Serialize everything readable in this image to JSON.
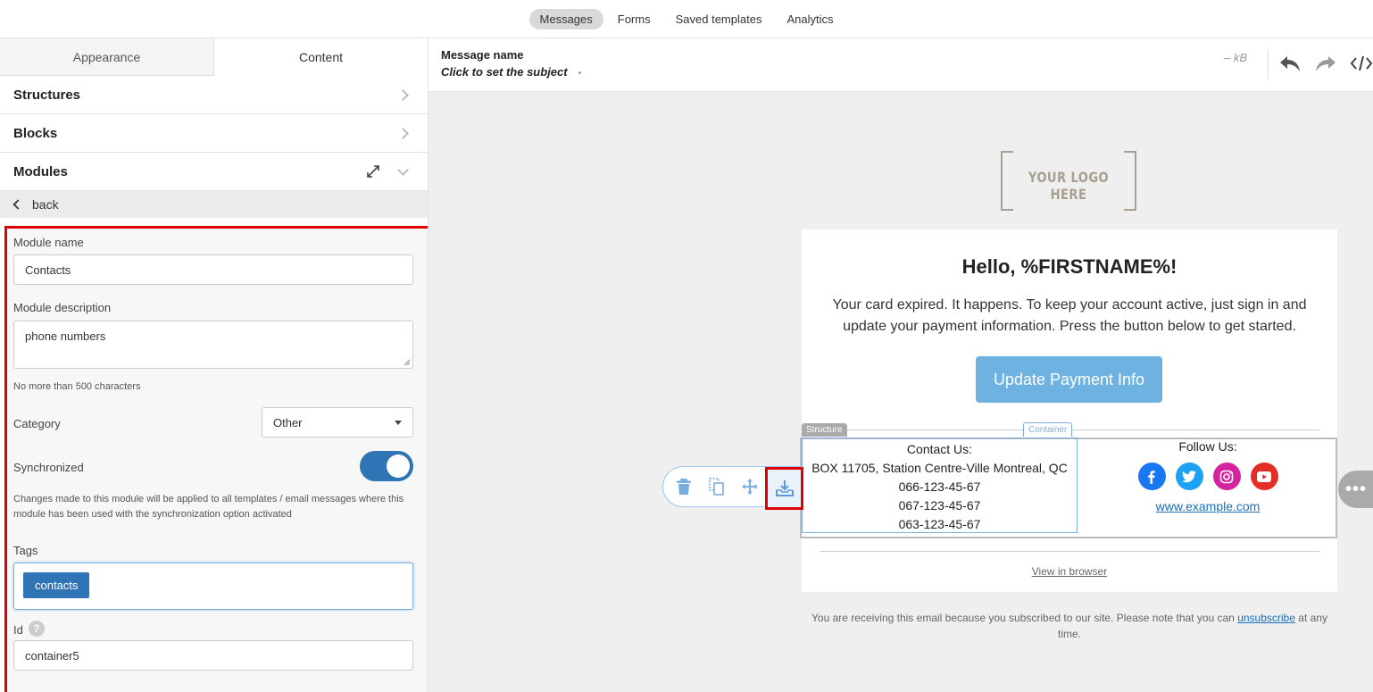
{
  "topnav": {
    "items": [
      {
        "label": "Messages",
        "active": true
      },
      {
        "label": "Forms"
      },
      {
        "label": "Saved templates"
      },
      {
        "label": "Analytics"
      }
    ]
  },
  "sidebar": {
    "tabs": [
      {
        "label": "Appearance"
      },
      {
        "label": "Content",
        "active": true
      }
    ],
    "sections": {
      "structures": "Structures",
      "blocks": "Blocks",
      "modules": "Modules"
    },
    "back_label": "back"
  },
  "module_form": {
    "name_label": "Module name",
    "name_value": "Contacts",
    "desc_label": "Module description",
    "desc_value": "phone numbers",
    "desc_hint": "No more than 500 characters",
    "category_label": "Category",
    "category_value": "Other",
    "sync_label": "Synchronized",
    "sync_on": true,
    "sync_hint": "Changes made to this module will be applied to all templates / email messages where this module has been used with the synchronization option activated",
    "tags_label": "Tags",
    "tags": [
      "contacts"
    ],
    "id_label": "Id",
    "id_help": "?",
    "id_value": "container5"
  },
  "editor_header": {
    "message_name_label": "Message name",
    "subject_placeholder": "Click to set the subject",
    "size": "– kB"
  },
  "email": {
    "logo_text": "YOUR LOGO HERE",
    "greeting": "Hello, %FIRSTNAME%!",
    "intro": "Your card expired. It happens. To keep your account active, just sign in and update your payment information. Press the button below to get started.",
    "cta_label": "Update Payment Info",
    "structure_label": "Structure",
    "container_label": "Container",
    "contact": {
      "title": "Contact Us:",
      "address": "BOX 11705, Station Centre-Ville Montreal, QC",
      "phones": [
        "066-123-45-67",
        "067-123-45-67",
        "063-123-45-67"
      ]
    },
    "follow": {
      "title": "Follow Us:",
      "link": "www.example.com",
      "colors": {
        "facebook": "#1877f2",
        "twitter": "#1da1f2",
        "instagram": "#d6249f",
        "youtube": "#e52d27"
      }
    },
    "view_in_browser": "View in browser",
    "footer_prefix": "You are receiving this email because you subscribed to our site. Please note that you can",
    "footer_link": "unsubscribe",
    "footer_suffix": "at any time."
  },
  "colors": {
    "accent": "#2f75b5",
    "cta": "#6eb2e1",
    "highlight": "#e00000"
  }
}
